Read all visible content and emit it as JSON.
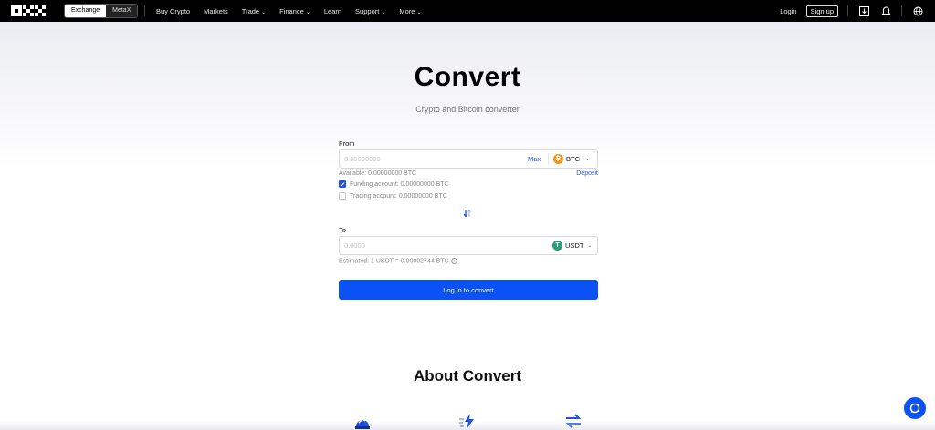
{
  "nav": {
    "switcher": {
      "active": "Exchange",
      "inactive": "MetaX"
    },
    "links": [
      {
        "label": "Buy Crypto",
        "has_dropdown": false
      },
      {
        "label": "Markets",
        "has_dropdown": false
      },
      {
        "label": "Trade",
        "has_dropdown": true
      },
      {
        "label": "Finance",
        "has_dropdown": true
      },
      {
        "label": "Learn",
        "has_dropdown": false
      },
      {
        "label": "Support",
        "has_dropdown": true
      },
      {
        "label": "More",
        "has_dropdown": true
      }
    ],
    "login": "Login",
    "signup": "Sign up",
    "icons": [
      "download-icon",
      "bell-icon",
      "globe-icon"
    ]
  },
  "hero": {
    "title": "Convert",
    "subtitle": "Crypto and Bitcoin converter"
  },
  "from": {
    "label": "From",
    "placeholder": "0.00000000",
    "max_label": "Max",
    "coin": "BTC",
    "coin_color": "#f7931a",
    "available": "Available: 0.00000000 BTC",
    "deposit_label": "Deposit",
    "funding_account": "Funding account: 0.00000000 BTC",
    "funding_checked": true,
    "trading_account": "Trading account: 0.00000000 BTC",
    "trading_checked": false
  },
  "to": {
    "label": "To",
    "placeholder": "0.0000",
    "coin": "USDT",
    "coin_color": "#26a17b",
    "estimated": "Estimated: 1 USDT = 0.00002744 BTC"
  },
  "cta_label": "Log in to convert",
  "about_title": "About Convert",
  "colors": {
    "accent": "#0a52f5",
    "link": "#1f52e0",
    "nav_bg": "#000000"
  }
}
